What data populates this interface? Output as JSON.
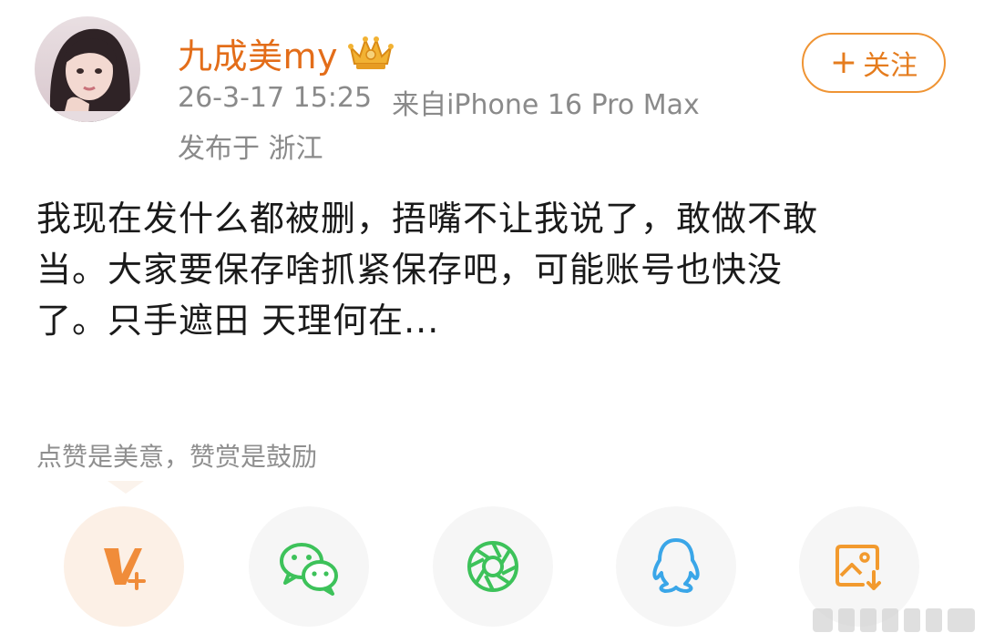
{
  "author": {
    "name": "九成美my",
    "badge": "crown-badge"
  },
  "post": {
    "date": "26-3-17 15:25",
    "source": "来自iPhone 16 Pro Max",
    "location": "发布于 浙江",
    "text": "我现在发什么都被删，捂嘴不让我说了，敢做不敢\n当。大家要保存啥抓紧保存吧，可能账号也快没\n了。只手遮田 天理何在..."
  },
  "follow": {
    "plus": "+",
    "label": "关注"
  },
  "reward": {
    "hint": "点赞是美意，赞赏是鼓励"
  },
  "share": {
    "icons": [
      "weibo-v-plus-icon",
      "wechat-icon",
      "moments-icon",
      "qq-icon",
      "save-image-icon"
    ]
  },
  "colors": {
    "accent_orange": "#e36d19",
    "meta_gray": "#8a8a8a",
    "wechat_green": "#3dc25a",
    "qq_blue": "#3aa6e8",
    "save_orange": "#f29a2e"
  }
}
